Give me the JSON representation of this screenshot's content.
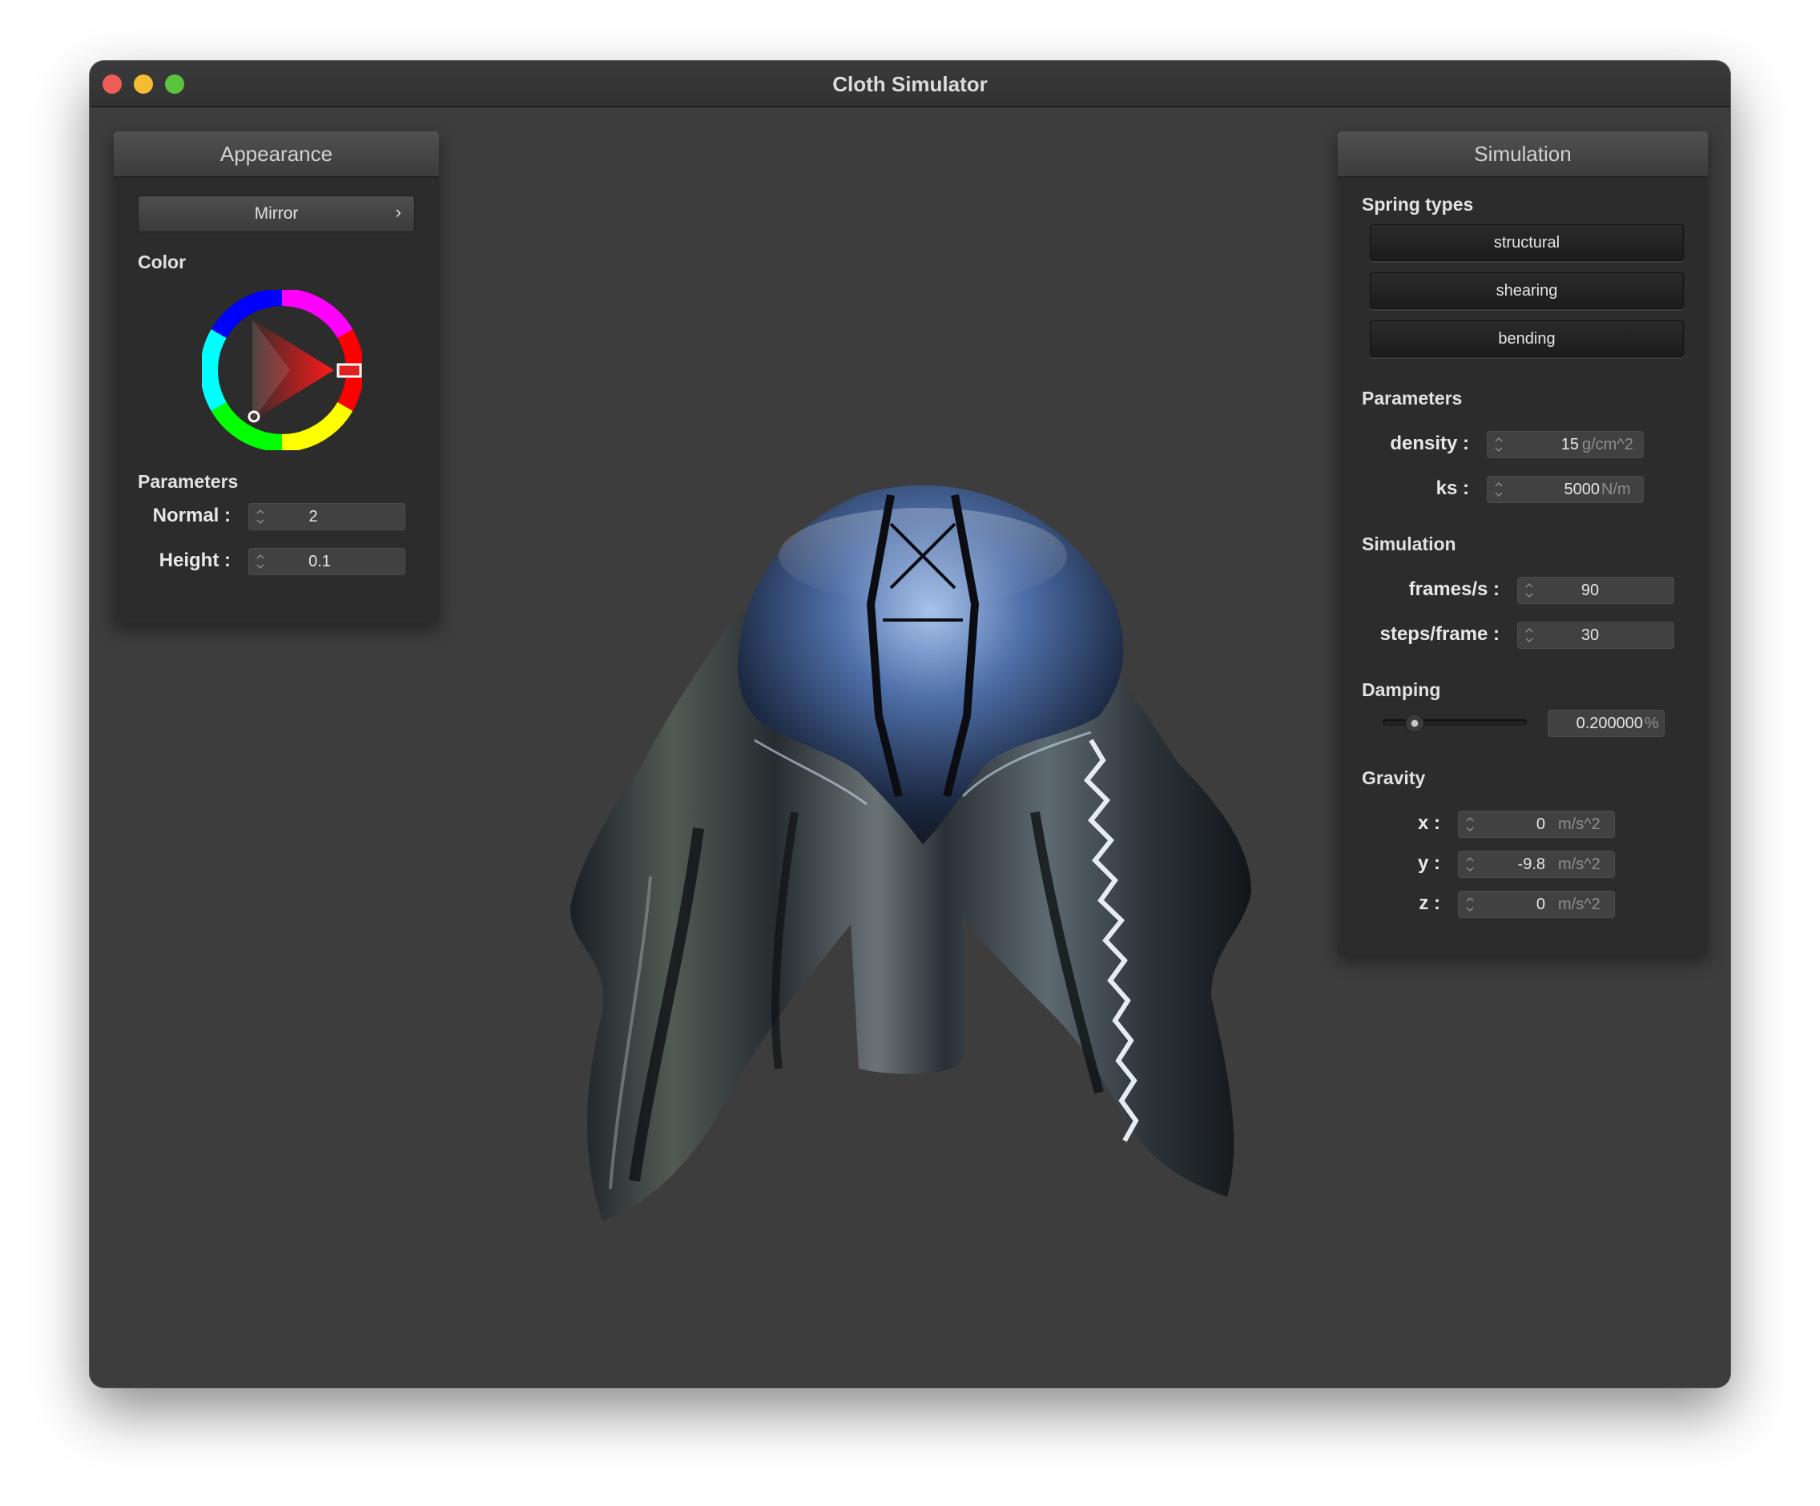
{
  "window": {
    "title": "Cloth Simulator"
  },
  "appearance": {
    "title": "Appearance",
    "material_button": "Mirror",
    "material_chevron": "›",
    "color_label": "Color",
    "color_value": "#ff2020",
    "parameters_label": "Parameters",
    "normal": {
      "label": "Normal :",
      "value": "2"
    },
    "height": {
      "label": "Height :",
      "value": "0.1"
    }
  },
  "simulation": {
    "title": "Simulation",
    "spring_types_label": "Spring types",
    "spring_buttons": [
      "structural",
      "shearing",
      "bending"
    ],
    "parameters_label": "Parameters",
    "density": {
      "label": "density :",
      "value": "15",
      "unit": "g/cm^2"
    },
    "ks": {
      "label": "ks :",
      "value": "5000",
      "unit": "N/m"
    },
    "simulation_label": "Simulation",
    "fps": {
      "label": "frames/s :",
      "value": "90"
    },
    "steps": {
      "label": "steps/frame :",
      "value": "30"
    },
    "damping_label": "Damping",
    "damping": {
      "value": "0.200000",
      "unit": "%",
      "slider_fraction": 0.2
    },
    "gravity_label": "Gravity",
    "gravity": {
      "x": {
        "label": "x :",
        "value": "0",
        "unit": "m/s^2"
      },
      "y": {
        "label": "y :",
        "value": "-9.8",
        "unit": "m/s^2"
      },
      "z": {
        "label": "z :",
        "value": "0",
        "unit": "m/s^2"
      }
    }
  }
}
